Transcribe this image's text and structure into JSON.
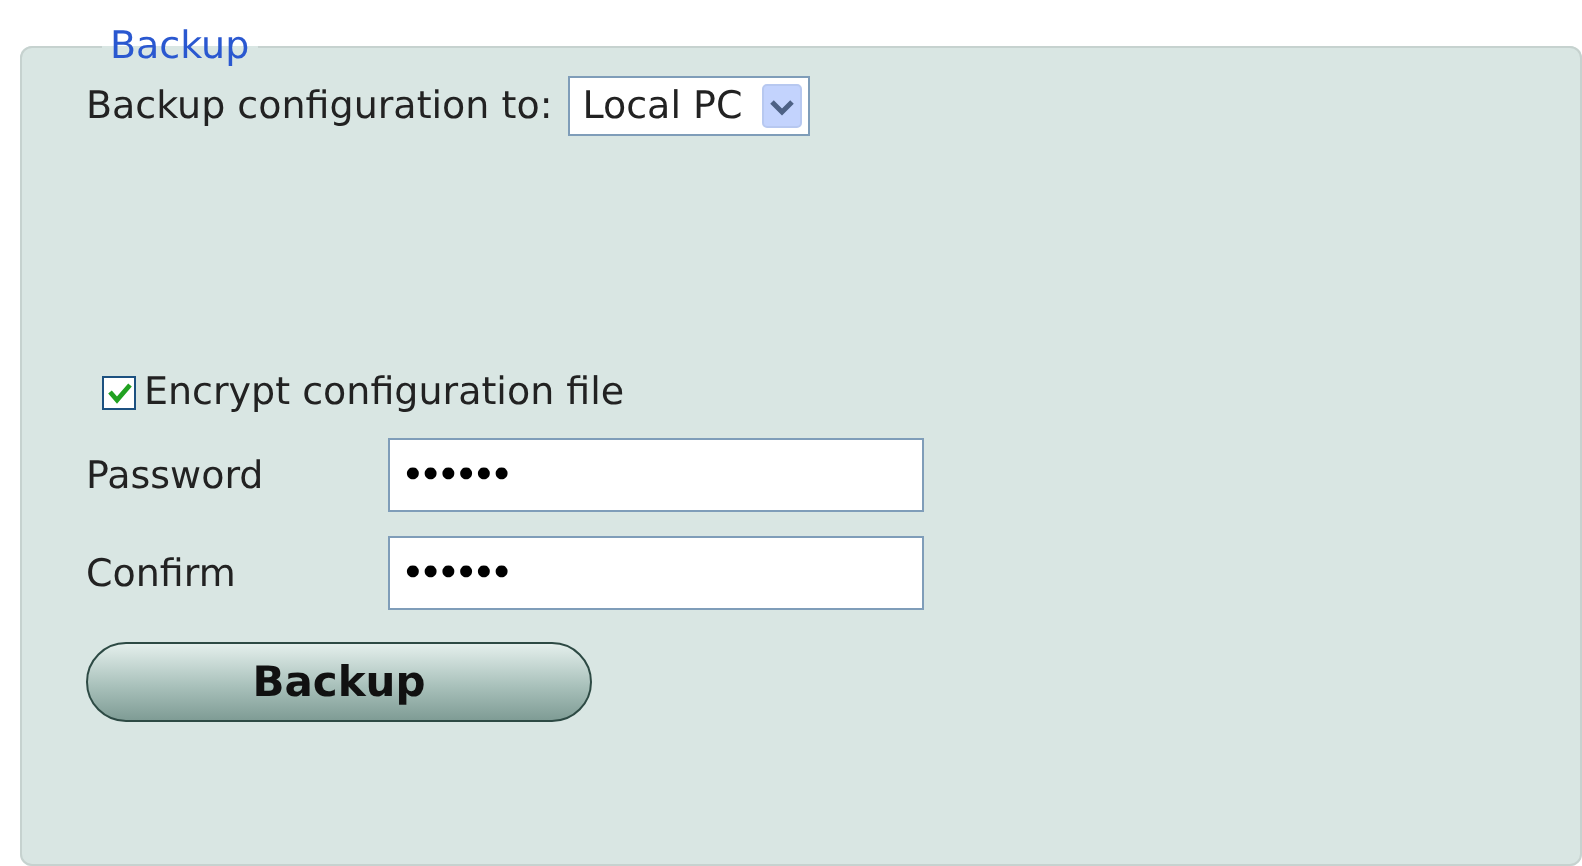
{
  "section": {
    "title": "Backup"
  },
  "destination": {
    "label": "Backup configuration to:",
    "value": "Local PC"
  },
  "encrypt": {
    "label": "Encrypt configuration file",
    "checked": true
  },
  "fields": [
    {
      "label": "Password",
      "value": "••••••"
    },
    {
      "label": "Confirm",
      "value": "••••••"
    }
  ],
  "button": {
    "label": "Backup"
  }
}
